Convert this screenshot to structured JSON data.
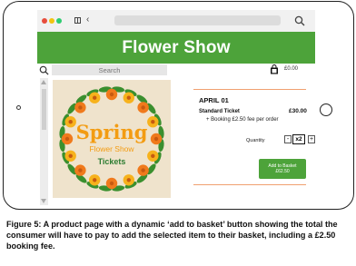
{
  "browser": {
    "window_controls": [
      "close",
      "minimize",
      "maximize"
    ],
    "back_icon": "chevron-left-icon",
    "search_icon": "search-icon"
  },
  "site": {
    "banner_title": "Flower Show",
    "banner_color": "#4da33a"
  },
  "search": {
    "placeholder": "Search"
  },
  "basket": {
    "icon": "shopping-bag-icon",
    "total": "£0.00"
  },
  "product_image": {
    "line1": "Spring",
    "line2": "Flower Show",
    "line3": "Tickets"
  },
  "product": {
    "date": "APRIL 01",
    "ticket_name": "Standard Ticket",
    "ticket_price": "£30.00",
    "booking_fee": "+ Booking £2.50 fee per order",
    "quantity_label": "Quantity",
    "quantity_minus": "-",
    "quantity_value": "x2",
    "quantity_plus": "+",
    "add_button_line1": "Add to Basket",
    "add_button_line2": "£62.50"
  },
  "caption": "Figure 5: A product page with a dynamic ‘add to basket’ button showing the total the consumer will have to pay to add the selected item to their basket, including a £2.50 booking fee."
}
